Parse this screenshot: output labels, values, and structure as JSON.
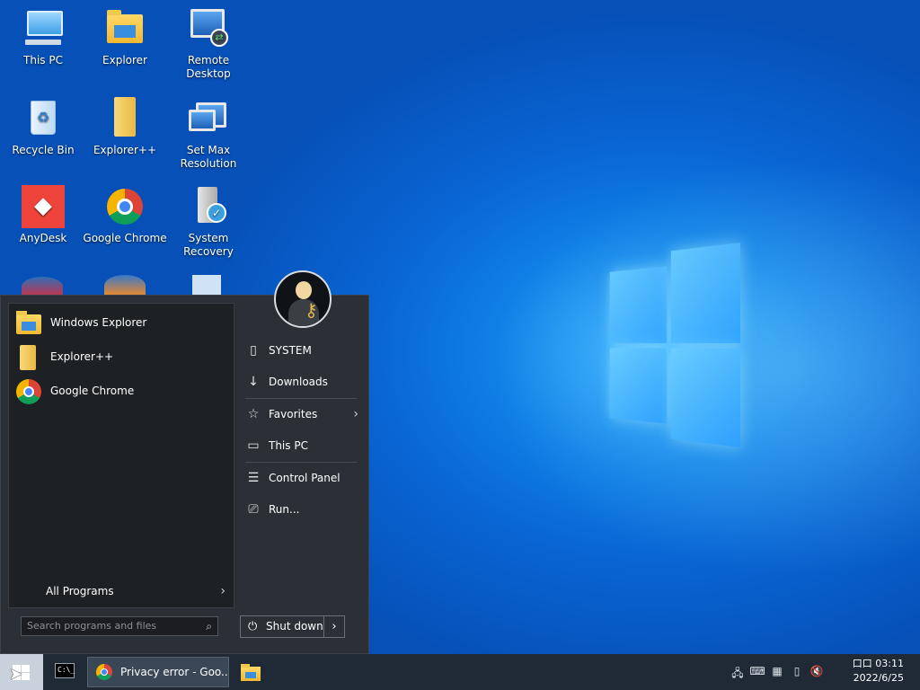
{
  "desktop": {
    "icons": [
      {
        "label": "This PC"
      },
      {
        "label": "Explorer"
      },
      {
        "label": "Remote Desktop"
      },
      {
        "label": "Recycle Bin"
      },
      {
        "label": "Explorer++"
      },
      {
        "label": "Set Max Resolution"
      },
      {
        "label": "AnyDesk"
      },
      {
        "label": "Google Chrome"
      },
      {
        "label": "System Recovery"
      }
    ]
  },
  "start_menu": {
    "pinned": [
      {
        "label": "Windows Explorer",
        "icon": "folder-icon"
      },
      {
        "label": "Explorer++",
        "icon": "tall-folder-icon"
      },
      {
        "label": "Google Chrome",
        "icon": "chrome-icon"
      }
    ],
    "all_programs": "All Programs",
    "search_placeholder": "Search programs and files",
    "right_items": [
      {
        "label": "SYSTEM",
        "icon": "user-folder-icon"
      },
      {
        "label": "Downloads",
        "icon": "download-icon"
      },
      {
        "label": "Favorites",
        "icon": "star-icon"
      },
      {
        "label": "This PC",
        "icon": "computer-icon"
      },
      {
        "label": "Control Panel",
        "icon": "control-panel-icon"
      },
      {
        "label": "Run...",
        "icon": "run-icon"
      }
    ],
    "shutdown": "Shut down"
  },
  "taskbar": {
    "chrome_window": "Privacy error - Goo...",
    "cmd_prompt": "C:\\_",
    "time": "03:11",
    "time_prefix": "口口",
    "date": "2022/6/25"
  },
  "colors": {
    "accent": "#0a6fd8",
    "taskbar": "#1f2a36",
    "start_menu": "#2b3036"
  }
}
